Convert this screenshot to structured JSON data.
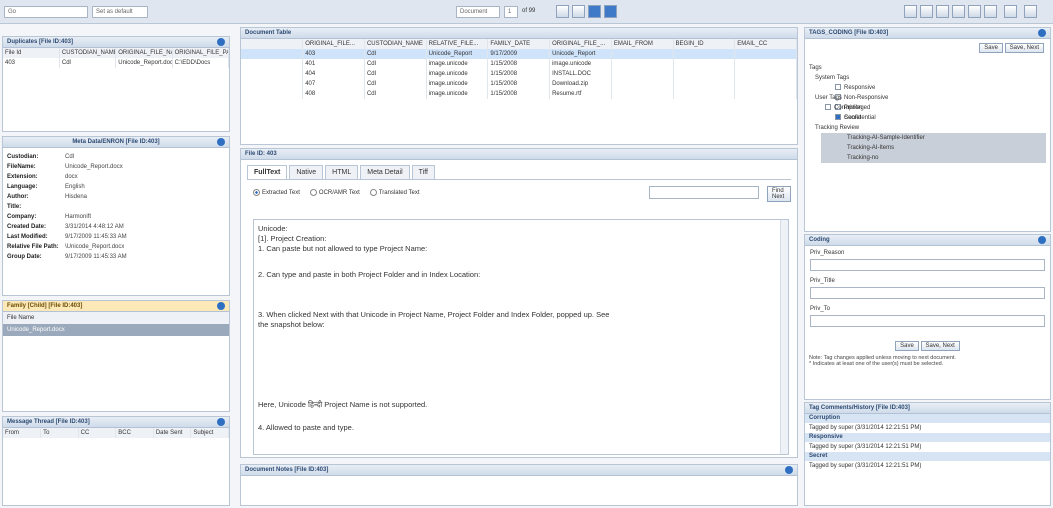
{
  "topbar": {
    "left_input": "Go",
    "left_input2": "Set as default",
    "page_label": "Document",
    "page_num": "1",
    "page_of": "of 99"
  },
  "left": {
    "panel1": {
      "title": "Duplicates [File ID:403]",
      "headers": [
        "File Id",
        "CUSTODIAN_NAME",
        "ORIGINAL_FILE_NAME",
        "ORIGINAL_FILE_PATH"
      ],
      "row": [
        "403",
        "Cdl",
        "Unicode_Report.docx",
        "C:\\EDD\\Docs"
      ]
    },
    "meta": {
      "title": "Meta Data/ENRON [File ID:403]",
      "fields": [
        {
          "k": "Custodian:",
          "v": "Cdl"
        },
        {
          "k": "FileName:",
          "v": "Unicode_Report.docx"
        },
        {
          "k": "Extension:",
          "v": "docx"
        },
        {
          "k": "Language:",
          "v": "English"
        },
        {
          "k": "Author:",
          "v": "Hisdena"
        },
        {
          "k": "Title:",
          "v": ""
        },
        {
          "k": "Company:",
          "v": "Harmonift"
        },
        {
          "k": "Created Date:",
          "v": "3/31/2014 4:48:12 AM"
        },
        {
          "k": "Last Modified:",
          "v": "9/17/2009 11:45:33 AM"
        },
        {
          "k": "Relative File Path:",
          "v": "\\Unicode_Report.docx"
        },
        {
          "k": "Group Date:",
          "v": "9/17/2009 11:45:33 AM"
        }
      ]
    },
    "family": {
      "title": "Family [Child] [File ID:403]",
      "item": "File Name",
      "selected": "Unicode_Report.docx"
    },
    "thread": {
      "title": "Message Thread [File ID:403]",
      "headers": [
        "From",
        "To",
        "CC",
        "BCC",
        "Date Sent",
        "Subject"
      ]
    }
  },
  "center": {
    "grid": {
      "title": "Document Table",
      "page": "1",
      "headers": [
        "",
        "ORIGINAL_FILE...",
        "CUSTODIAN_NAME",
        "RELATIVE_FILE...",
        "FAMILY_DATE",
        "ORIGINAL_FILE_...",
        "EMAIL_FROM",
        "BEGIN_ID",
        "EMAIL_CC"
      ],
      "rows": [
        [
          "",
          "403",
          "Cdl",
          "Unicode_Report",
          "9/17/2009",
          "Unicode_Report",
          "",
          "",
          ""
        ],
        [
          "",
          "401",
          "Cdl",
          "image.unicode",
          "1/15/2008",
          "image.unicode",
          "",
          "",
          ""
        ],
        [
          "",
          "404",
          "Cdl",
          "image.unicode",
          "1/15/2008",
          "INSTALL.DOC",
          "",
          "",
          ""
        ],
        [
          "",
          "407",
          "Cdl",
          "image.unicode",
          "1/15/2008",
          "Download.zip",
          "",
          "",
          ""
        ],
        [
          "",
          "408",
          "Cdl",
          "image.unicode",
          "1/15/2008",
          "Resume.rtf",
          "",
          "",
          ""
        ]
      ]
    },
    "file_title": "File ID: 403",
    "tabs": [
      "FullText",
      "Native",
      "HTML",
      "Meta Detail",
      "Tiff"
    ],
    "radios": [
      "Extracted Text",
      "OCR/AMR Text",
      "Translated Text"
    ],
    "find_next": "Find Next",
    "doc_lines": [
      "Unicode:",
      "[1]. Project Creation:",
      "1. Can paste but not allowed to type Project Name:",
      "2. Can type and paste in both Project Folder and in Index Location:",
      "3. When clicked Next with that Unicode in Project Name, Project Folder and Index Folder, popped up. See",
      "the snapshot below:",
      "Here, Unicode हिन्दी Project Name is not supported.",
      "4. Allowed to paste and type."
    ],
    "notes_title": "Document Notes [File ID:403]"
  },
  "right": {
    "tag_title": "TAGS_CODING [File ID:403]",
    "save": "Save",
    "save_next": "Save, Next",
    "tags_root": "Tags",
    "system_tags": "System Tags",
    "sys_items": [
      "Responsive",
      "Non-Responsive",
      "Privileged",
      "Confidential"
    ],
    "user_tags": "User Tags",
    "user_group": "Corruption",
    "user_item": "Secret",
    "tracking": "Tracking Review",
    "tracking_items": [
      "Tracking-AI-Sample-Identifier",
      "Tracking-AI-Items",
      "Tracking-no"
    ],
    "coding_title": "Coding",
    "coding_fields": [
      "Priv_Reason",
      "Priv_Title",
      "Priv_To"
    ],
    "note": "Note: Tag changes applied unless moving to next document.",
    "note2": "* Indicates at least one of the user(s) must be selected.",
    "comments_title": "Tag Comments/History [File ID:403]",
    "history": [
      {
        "tag": "Corruption",
        "by": "Tagged by super (3/31/2014 12:21:51 PM)"
      },
      {
        "tag": "Responsive",
        "by": "Tagged by super (3/31/2014 12:21:51 PM)"
      },
      {
        "tag": "Secret",
        "by": "Tagged by super (3/31/2014 12:21:51 PM)"
      }
    ]
  }
}
